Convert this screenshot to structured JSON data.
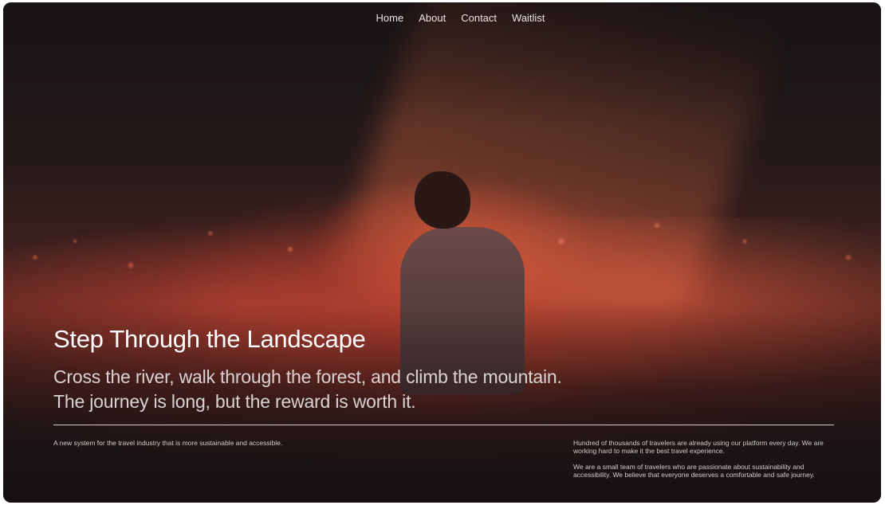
{
  "nav": {
    "items": [
      {
        "label": "Home"
      },
      {
        "label": "About"
      },
      {
        "label": "Contact"
      },
      {
        "label": "Waitlist"
      }
    ]
  },
  "hero": {
    "title": "Step Through the Landscape",
    "subtitle": "Cross the river, walk through the forest, and climb the mountain. The journey is long, but the reward is worth it."
  },
  "footer": {
    "tagline": "A new system for the travel industry that is more sustainable and accessible.",
    "paragraph_1": "Hundred of thousands of travelers are already using our platform every day. We are working hard to make it the best travel experience.",
    "paragraph_2": "We are a small team of travelers who are passionate about sustainability and accessibility. We believe that everyone deserves a comfortable and safe journey."
  },
  "colors": {
    "background": "#1c1517",
    "accent_glow": "#e8603e",
    "text_primary": "#ffffff",
    "text_secondary": "#d9d3d2"
  },
  "icons": {
    "hero_image": "person-in-glowing-flower-field-image"
  }
}
